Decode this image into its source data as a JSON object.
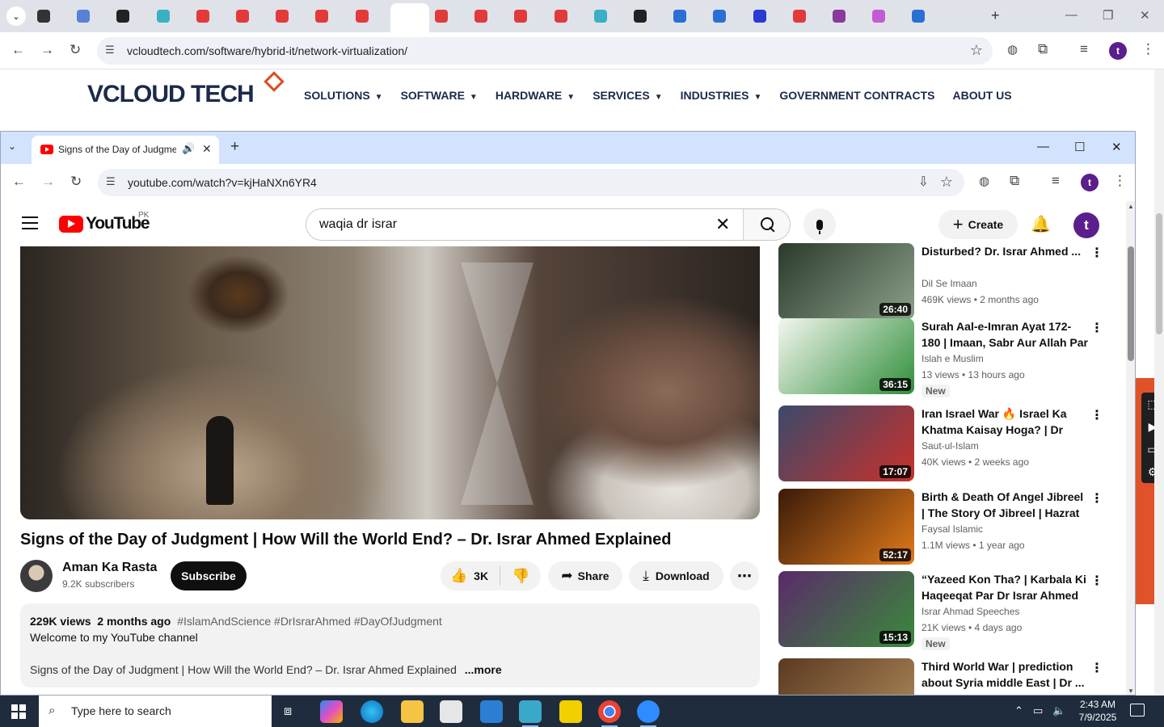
{
  "back_window": {
    "url": "vcloudtech.com/software/hybrid-it/network-virtualization/",
    "tab_count": 23,
    "site": {
      "logo": "VCLOUD TECH",
      "nav": [
        "SOLUTIONS",
        "SOFTWARE",
        "HARDWARE",
        "SERVICES",
        "INDUSTRIES",
        "GOVERNMENT CONTRACTS",
        "ABOUT US"
      ],
      "nav_has_dropdown": [
        true,
        true,
        true,
        true,
        true,
        false,
        false
      ]
    },
    "profile_initial": "t"
  },
  "front_window": {
    "tab_title": "Signs of the Day of Judgment",
    "url": "youtube.com/watch?v=kjHaNXn6YR4",
    "profile_initial": "t"
  },
  "youtube": {
    "logo_text": "YouTube",
    "country_code": "PK",
    "search_value": "waqia dr israr",
    "create_label": "Create",
    "avatar_initial": "t",
    "video": {
      "title": "Signs of the Day of Judgment | How Will the World End? – Dr. Israr Ahmed Explained",
      "channel": "Aman Ka Rasta",
      "subscribers": "9.2K subscribers",
      "subscribe_label": "Subscribe",
      "likes": "3K",
      "share_label": "Share",
      "download_label": "Download",
      "views": "229K views",
      "date": "2 months ago",
      "hashtags": "#IslamAndScience #DrIsrarAhmed #DayOfJudgment",
      "desc_line1": "Welcome to my YouTube channel",
      "desc_line2": "Signs of the Day of Judgment | How Will the World End? – Dr. Israr Ahmed Explained",
      "more_label": "...more"
    },
    "recommendations": [
      {
        "title": "Disturbed? Dr. Israr Ahmed ...",
        "channel": "Dil Se Imaan",
        "meta": "469K views • 2 months ago",
        "duration": "26:40",
        "badge": "",
        "c1": "#2b3a2a",
        "c2": "#8aa08a"
      },
      {
        "title": "Surah Aal-e-Imran Ayat 172-180 | Imaan, Sabr Aur Allah Par ...",
        "channel": "Islah e Muslim",
        "meta": "13 views • 13 hours ago",
        "duration": "36:15",
        "badge": "New",
        "c1": "#f4f6ef",
        "c2": "#2f8f3a"
      },
      {
        "title": "Iran Israel War 🔥 Israel Ka Khatma Kaisay Hoga? | Dr Isra...",
        "channel": "Saut-ul-Islam",
        "meta": "40K views • 2 weeks ago",
        "duration": "17:07",
        "badge": "",
        "c1": "#3a4a6a",
        "c2": "#c9302c"
      },
      {
        "title": "Birth & Death Of Angel Jibreel | The Story Of Jibreel | Hazrat ...",
        "channel": "Faysal Islamic",
        "meta": "1.1M views • 1 year ago",
        "duration": "52:17",
        "badge": "",
        "c1": "#3a1a0a",
        "c2": "#e07a1a"
      },
      {
        "title": "“Yazeed Kon Tha? | Karbala Ki Haqeeqat Par Dr Israr Ahmed ...",
        "channel": "Israr Ahmad Speeches",
        "meta": "21K views • 4 days ago",
        "duration": "15:13",
        "badge": "New",
        "c1": "#5a2a6a",
        "c2": "#3a8a3a"
      },
      {
        "title": "Third World War | prediction about Syria middle East | Dr ...",
        "channel": "",
        "meta": "",
        "duration": "",
        "badge": "",
        "c1": "#5a3a22",
        "c2": "#b08a5a"
      }
    ]
  },
  "taskbar": {
    "search_placeholder": "Type here to search",
    "time": "2:43 AM",
    "date": "7/9/2025"
  }
}
